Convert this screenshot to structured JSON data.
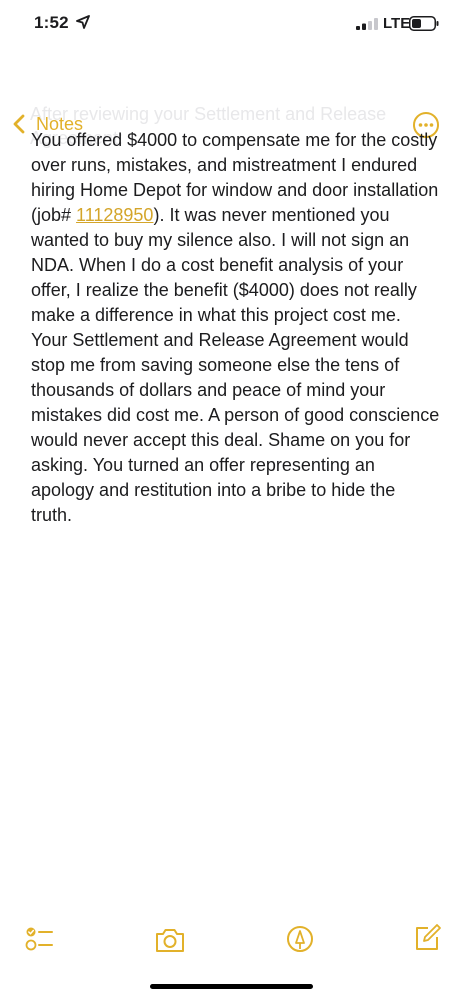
{
  "status_bar": {
    "time": "1:52",
    "network": "LTE",
    "location_icon": "location-arrow-icon",
    "signal_icon": "cellular-signal-icon",
    "battery_icon": "battery-icon"
  },
  "nav": {
    "back_label": "Notes",
    "back_icon": "chevron-left-icon",
    "title": "After reviewing your Settlement and Release Agreement:",
    "more_icon": "ellipsis-circle-icon",
    "accent_color": "#e2b12a"
  },
  "note": {
    "segment_1": "You offered $4000 to compensate me for the costly over runs, mistakes, and mistreatment I endured hiring Home Depot for window and door installation (job# ",
    "job_number": "11128950",
    "segment_2": ").  It was never mentioned you wanted to buy my silence also. I will not sign an NDA.  When I do a cost benefit analysis of your offer, I realize the benefit ($4000) does not really make a difference in what this project cost me. Your Settlement and Release Agreement would stop me from saving someone else the tens of thousands of dollars and peace of mind your mistakes did cost me. A person of good conscience would never accept this deal.  Shame on you for asking. You turned an offer representing an apology and restitution into a bribe to hide the truth."
  },
  "toolbar": {
    "checklist_icon": "checklist-icon",
    "camera_icon": "camera-icon",
    "markup_icon": "markup-pen-icon",
    "compose_icon": "compose-icon"
  }
}
